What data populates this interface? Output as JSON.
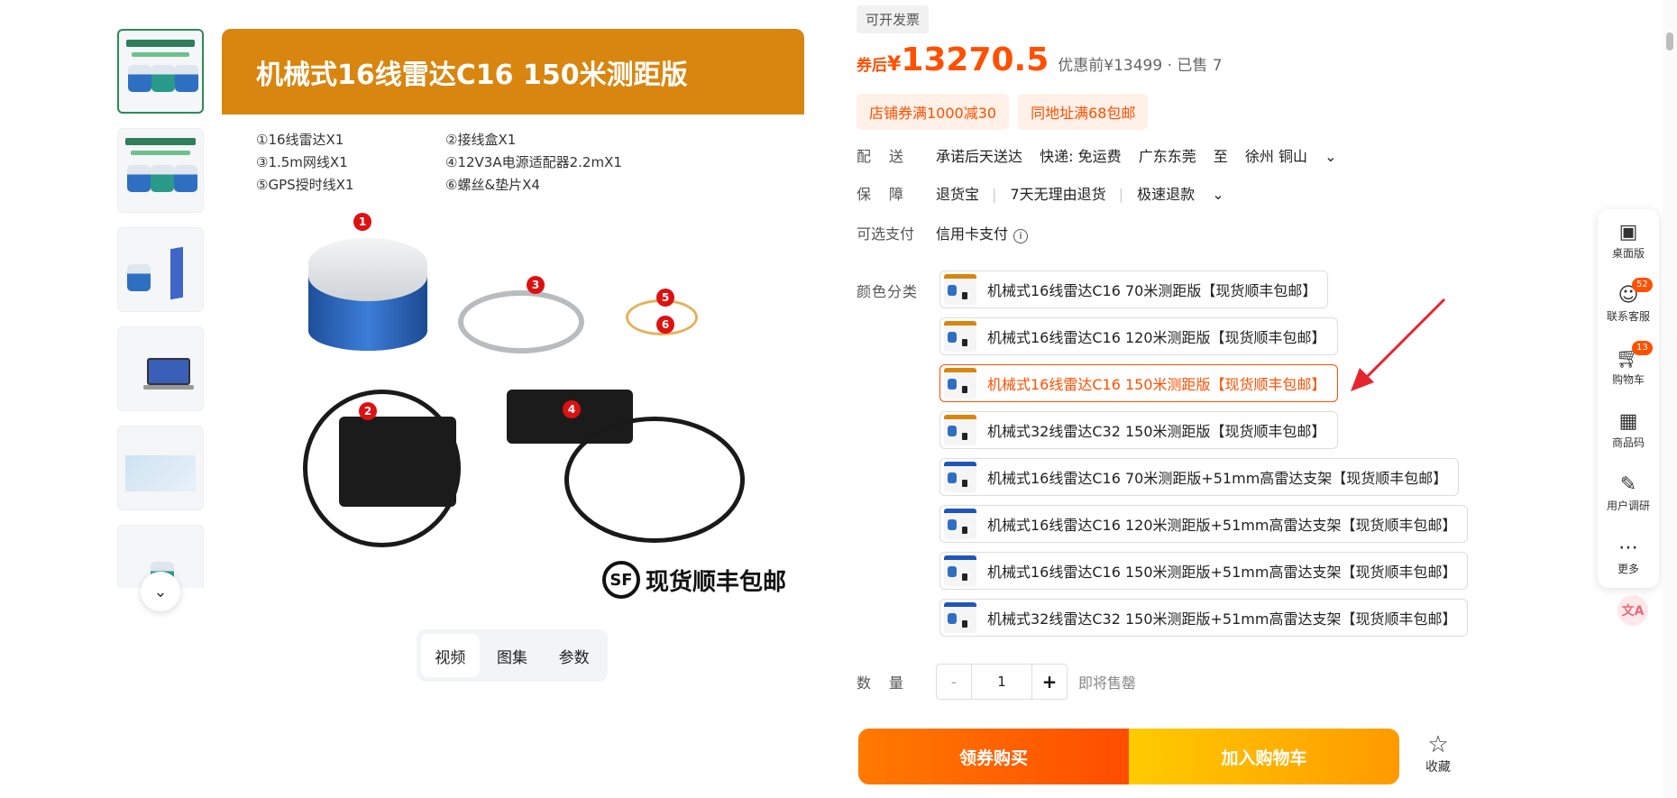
{
  "gallery": {
    "more_icon": "chevron-down-icon",
    "main_title": "机械式16线雷达C16 150米测距版",
    "contents": [
      "①16线雷达X1",
      "②接线盒X1",
      "③1.5m网线X1",
      "④12V3A电源适配器2.2mX1",
      "⑤GPS授时线X1",
      "⑥螺丝&垫片X4"
    ],
    "badges": [
      "1",
      "2",
      "3",
      "4",
      "5",
      "6"
    ],
    "sf_mark": "SF",
    "sf_text": "现货顺丰包邮",
    "tabs": [
      "视频",
      "图集",
      "参数"
    ]
  },
  "product": {
    "invoice_tag": "可开发票",
    "price_prefix": "券后",
    "price_symbol": "¥",
    "price": "13270.5",
    "price_original": "优惠前¥13499 · 已售 7",
    "coupons": [
      "店铺券满1000减30",
      "同地址满68包邮"
    ],
    "delivery_label": "配　送",
    "delivery": [
      "承诺后天送达",
      "快递: 免运费",
      "广东东莞",
      "至",
      "徐州 铜山"
    ],
    "guarantee_label": "保　障",
    "guarantee": [
      "退货宝",
      "7天无理由退货",
      "极速退款"
    ],
    "payment_label": "可选支付",
    "payment": "信用卡支付",
    "variants_label": "颜色分类",
    "variants": [
      "机械式16线雷达C16 70米测距版【现货顺丰包邮】",
      "机械式16线雷达C16 120米测距版【现货顺丰包邮】",
      "机械式16线雷达C16 150米测距版【现货顺丰包邮】",
      "机械式32线雷达C32 150米测距版【现货顺丰包邮】",
      "机械式16线雷达C16 70米测距版+51mm高雷达支架【现货顺丰包邮】",
      "机械式16线雷达C16 120米测距版+51mm高雷达支架【现货顺丰包邮】",
      "机械式16线雷达C16 150米测距版+51mm高雷达支架【现货顺丰包邮】",
      "机械式32线雷达C32 150米测距版+51mm高雷达支架【现货顺丰包邮】"
    ],
    "selected_variant_index": 2,
    "quantity_label": "数　量",
    "quantity_minus": "-",
    "quantity": "1",
    "quantity_plus": "+",
    "stock_note": "即将售罄",
    "buy_label": "领券购买",
    "cart_label": "加入购物车",
    "fav_label": "收藏",
    "accent_color": "#ff5000"
  },
  "toolbar": {
    "items": [
      {
        "label": "桌面版",
        "icon": "desktop-icon"
      },
      {
        "label": "联系客服",
        "icon": "customer-service-icon",
        "badge": "52"
      },
      {
        "label": "购物车",
        "icon": "cart-icon",
        "badge": "13"
      },
      {
        "label": "商品码",
        "icon": "qrcode-icon"
      },
      {
        "label": "用户调研",
        "icon": "survey-icon"
      },
      {
        "label": "更多",
        "icon": "more-icon"
      }
    ],
    "translate_icon": "translate-icon"
  }
}
